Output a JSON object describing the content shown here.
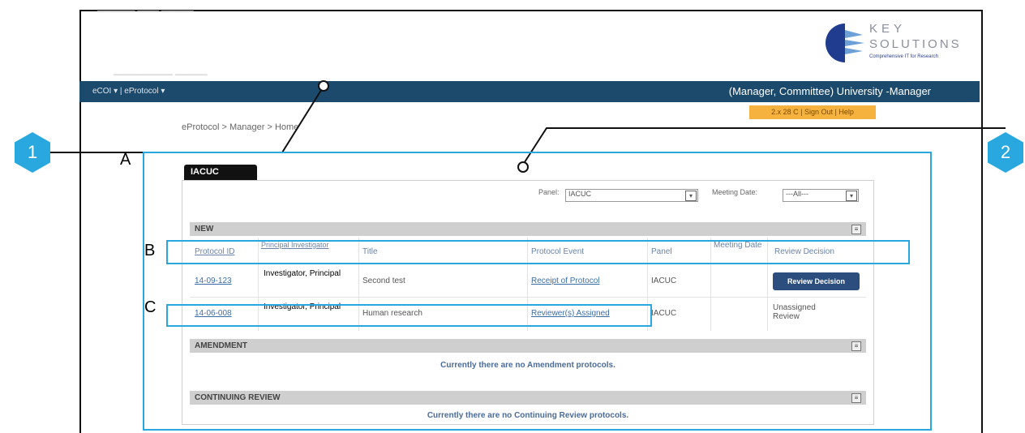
{
  "app": {
    "logo_line1": "KEY",
    "logo_line2": "SOLUTIONS",
    "logo_tagline": "Comprehensive IT for Research",
    "nav_modules": "eCOI ▾ | eProtocol ▾",
    "user_label": "(Manager, Committee) University -Manager",
    "top_links": "2.x 28 C | Sign Out | Help",
    "breadcrumb": "eProtocol > Manager > Home"
  },
  "callouts": {
    "one": "1",
    "two": "2"
  },
  "region_labels": {
    "a": "A",
    "b": "B",
    "c": "C"
  },
  "tab": {
    "label": "IACUC"
  },
  "filters": {
    "panel_label": "Panel:",
    "panel_value": "IACUC",
    "meeting_label": "Meeting Date:",
    "meeting_value": "---All---"
  },
  "sections": {
    "new": "NEW",
    "amendment": "AMENDMENT",
    "continuing": "CONTINUING REVIEW",
    "toggle": "≡"
  },
  "table": {
    "headers": {
      "protocol_id": "Protocol ID",
      "pi": "Principal Investigator",
      "title": "Title",
      "event": "Protocol Event",
      "panel": "Panel",
      "meeting": "Meeting Date",
      "decision": "Review Decision"
    },
    "rows": [
      {
        "protocol_id": "14-09-123",
        "pi": "Investigator, Principal",
        "title": "Second test",
        "event": "Receipt of Protocol",
        "panel": "IACUC",
        "meeting": "",
        "decision_button": "Review Decision"
      },
      {
        "protocol_id": "14-06-008",
        "pi": "Investigator, Principal",
        "title": "Human research",
        "event": "Reviewer(s) Assigned",
        "panel": "IACUC",
        "meeting": "",
        "decision_text": "Unassigned Review"
      }
    ]
  },
  "empty_messages": {
    "amendment": "Currently there are no Amendment protocols.",
    "continuing": "Currently there are no Continuing Review protocols."
  },
  "colors": {
    "callout": "#29a8e0",
    "navbar": "#1c4a6c",
    "accent_orange": "#f6b23e",
    "button": "#2c4e7e"
  }
}
